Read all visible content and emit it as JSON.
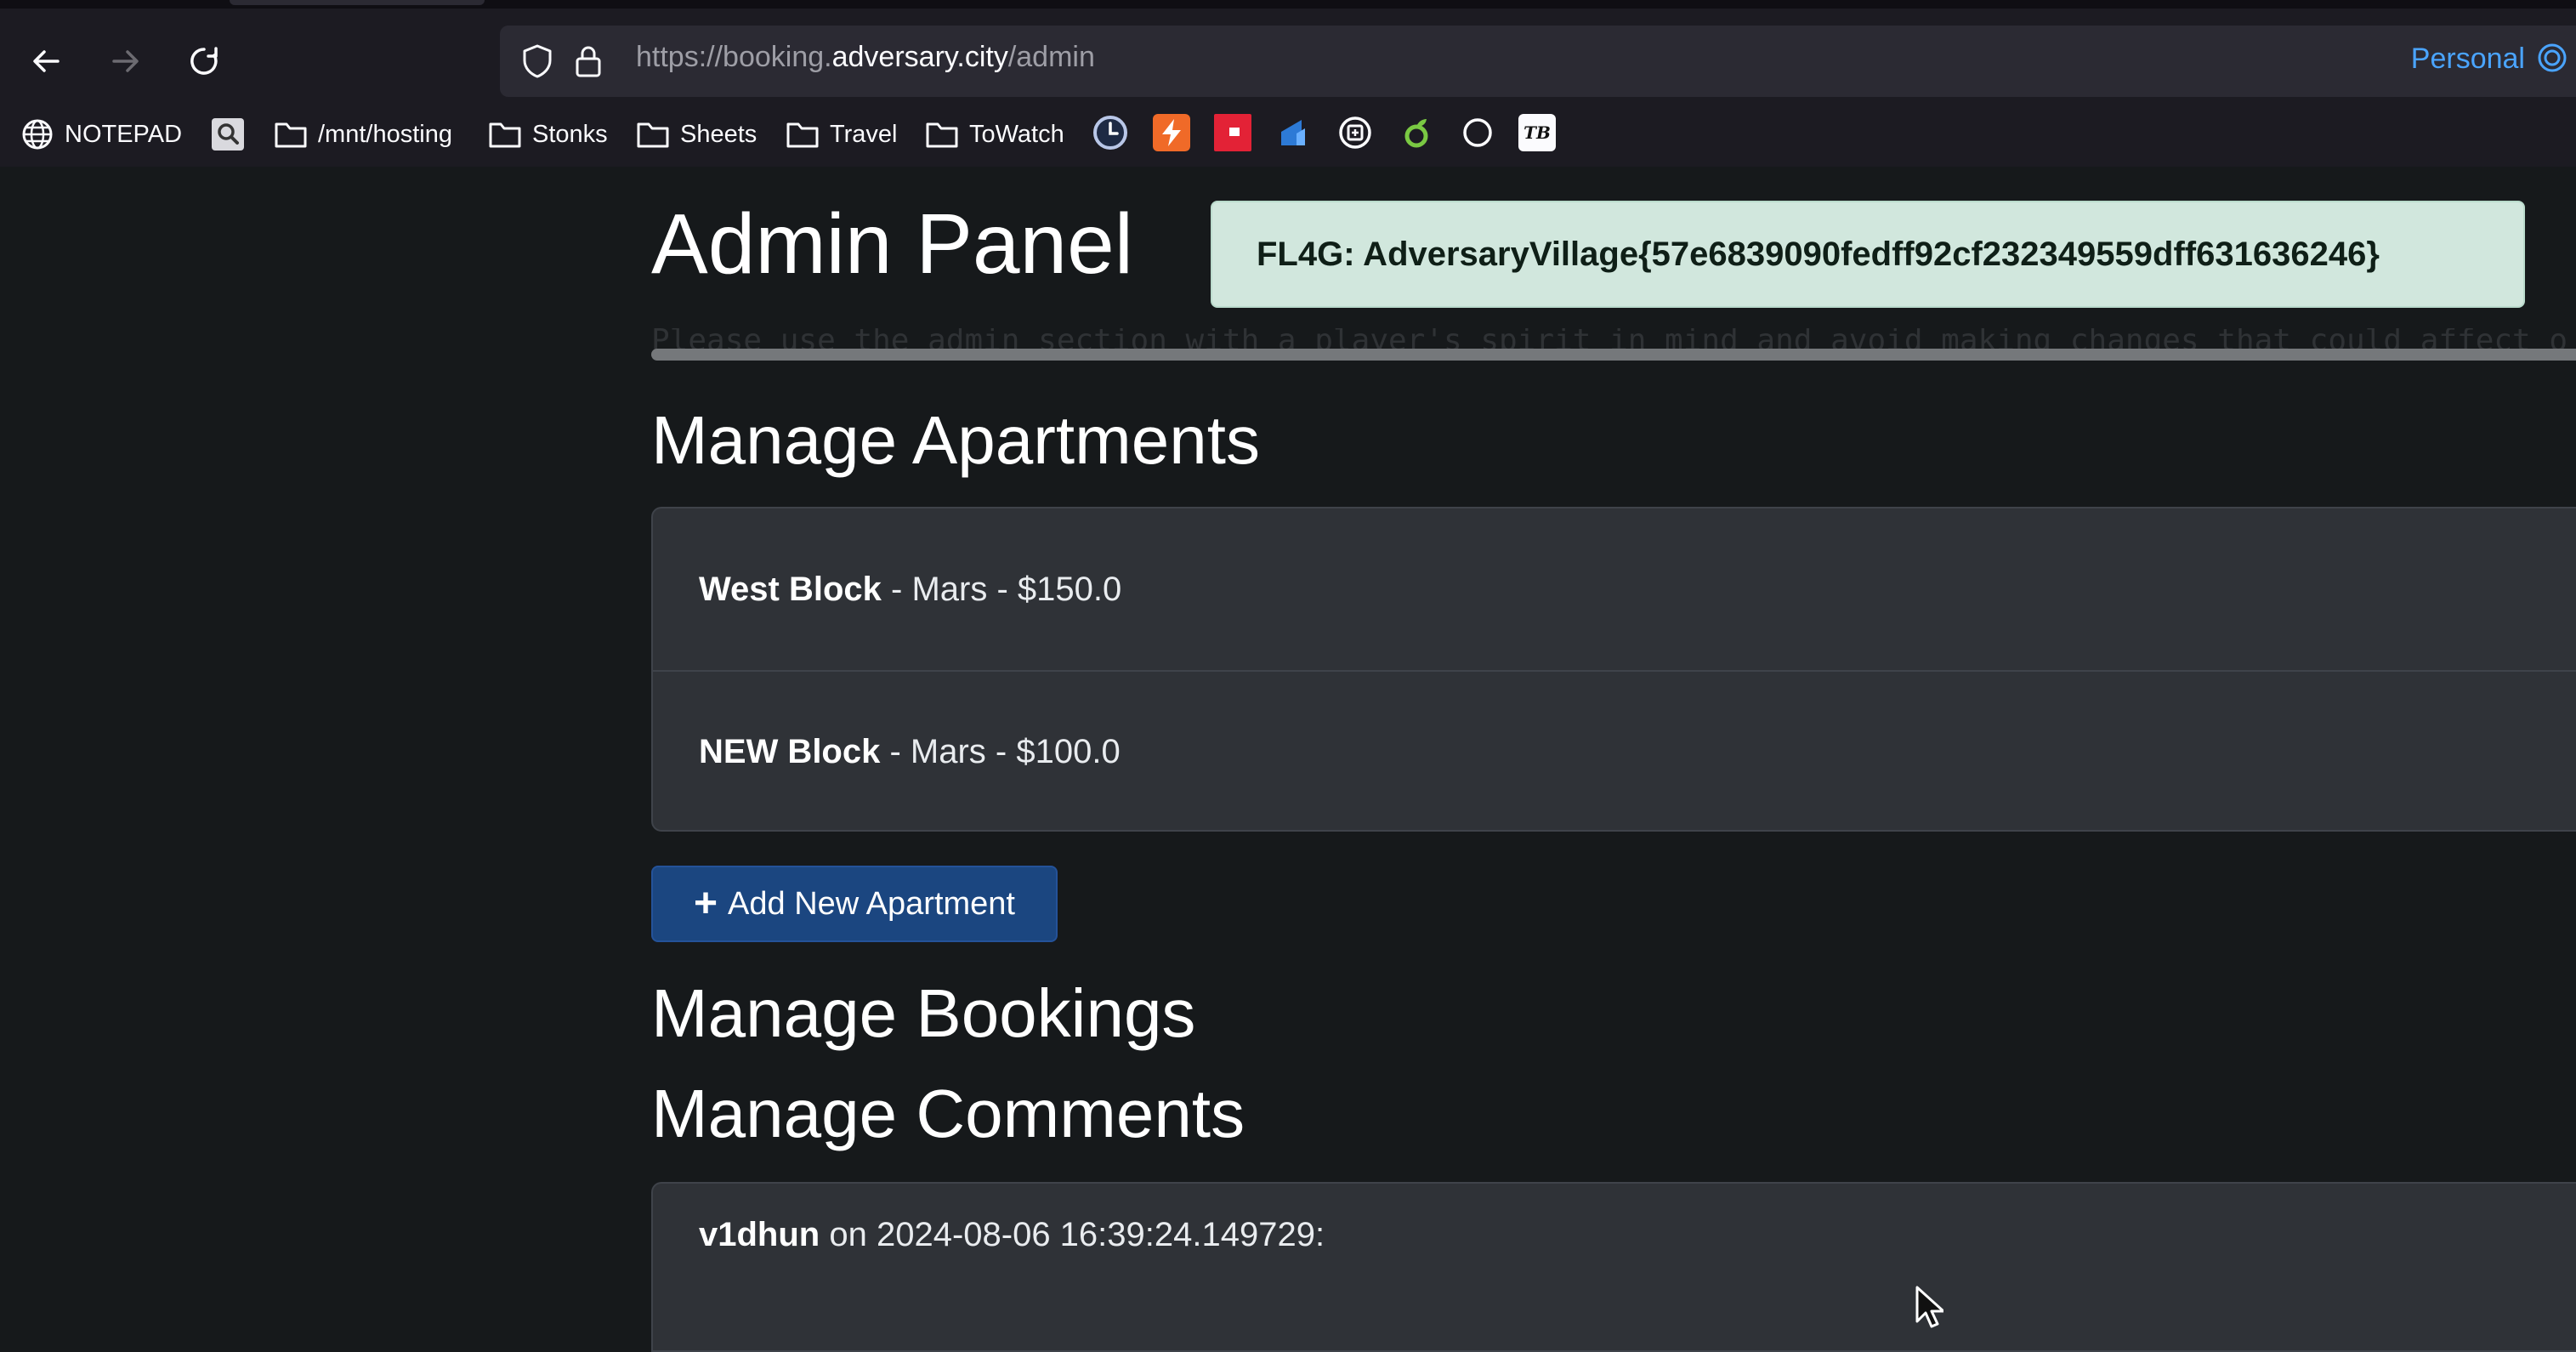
{
  "browser": {
    "url": {
      "prefix": "https://booking.",
      "host": "adversary.city",
      "path": "/admin"
    },
    "profile_label": "Personal",
    "bookmarks": [
      {
        "label": "NOTEPAD",
        "icon": "globe-icon"
      },
      {
        "label": "",
        "icon": "search-icon"
      },
      {
        "label": "/mnt/hosting",
        "icon": "folder-icon"
      },
      {
        "label": "Stonks",
        "icon": "folder-icon"
      },
      {
        "label": "Sheets",
        "icon": "folder-icon"
      },
      {
        "label": "Travel",
        "icon": "folder-icon"
      },
      {
        "label": "ToWatch",
        "icon": "folder-icon"
      }
    ],
    "favicon_bookmarks": [
      "clock-icon",
      "bolt-icon",
      "red-flag-icon",
      "blue-shape-icon",
      "gear-badge-icon",
      "green-leaf-icon",
      "circle-icon",
      "tb-icon"
    ],
    "favicon_tb_text": "TB"
  },
  "page": {
    "title": "Admin Panel",
    "flag_text": "FL4G: AdversaryVillage{57e6839090fedff92cf232349559dff631636246}",
    "notice": "Please use the admin section with a player's spirit in mind and avoid making changes that could affect o",
    "sections": {
      "apartments": "Manage Apartments",
      "bookings": "Manage Bookings",
      "comments": "Manage Comments"
    },
    "apartments": [
      {
        "name": "West Block",
        "details": " - Mars - $150.0"
      },
      {
        "name": "NEW Block",
        "details": " - Mars - $100.0"
      }
    ],
    "add_apartment_label": "Add New Apartment",
    "comment": {
      "user": "v1dhun",
      "meta": " on 2024-08-06 16:39:24.149729:"
    }
  },
  "colors": {
    "alert_bg": "#d1e7dd",
    "primary_button": "#1b4680",
    "page_bg": "#16191b",
    "card_bg": "#2f3237",
    "link_blue": "#4aa4ff"
  }
}
